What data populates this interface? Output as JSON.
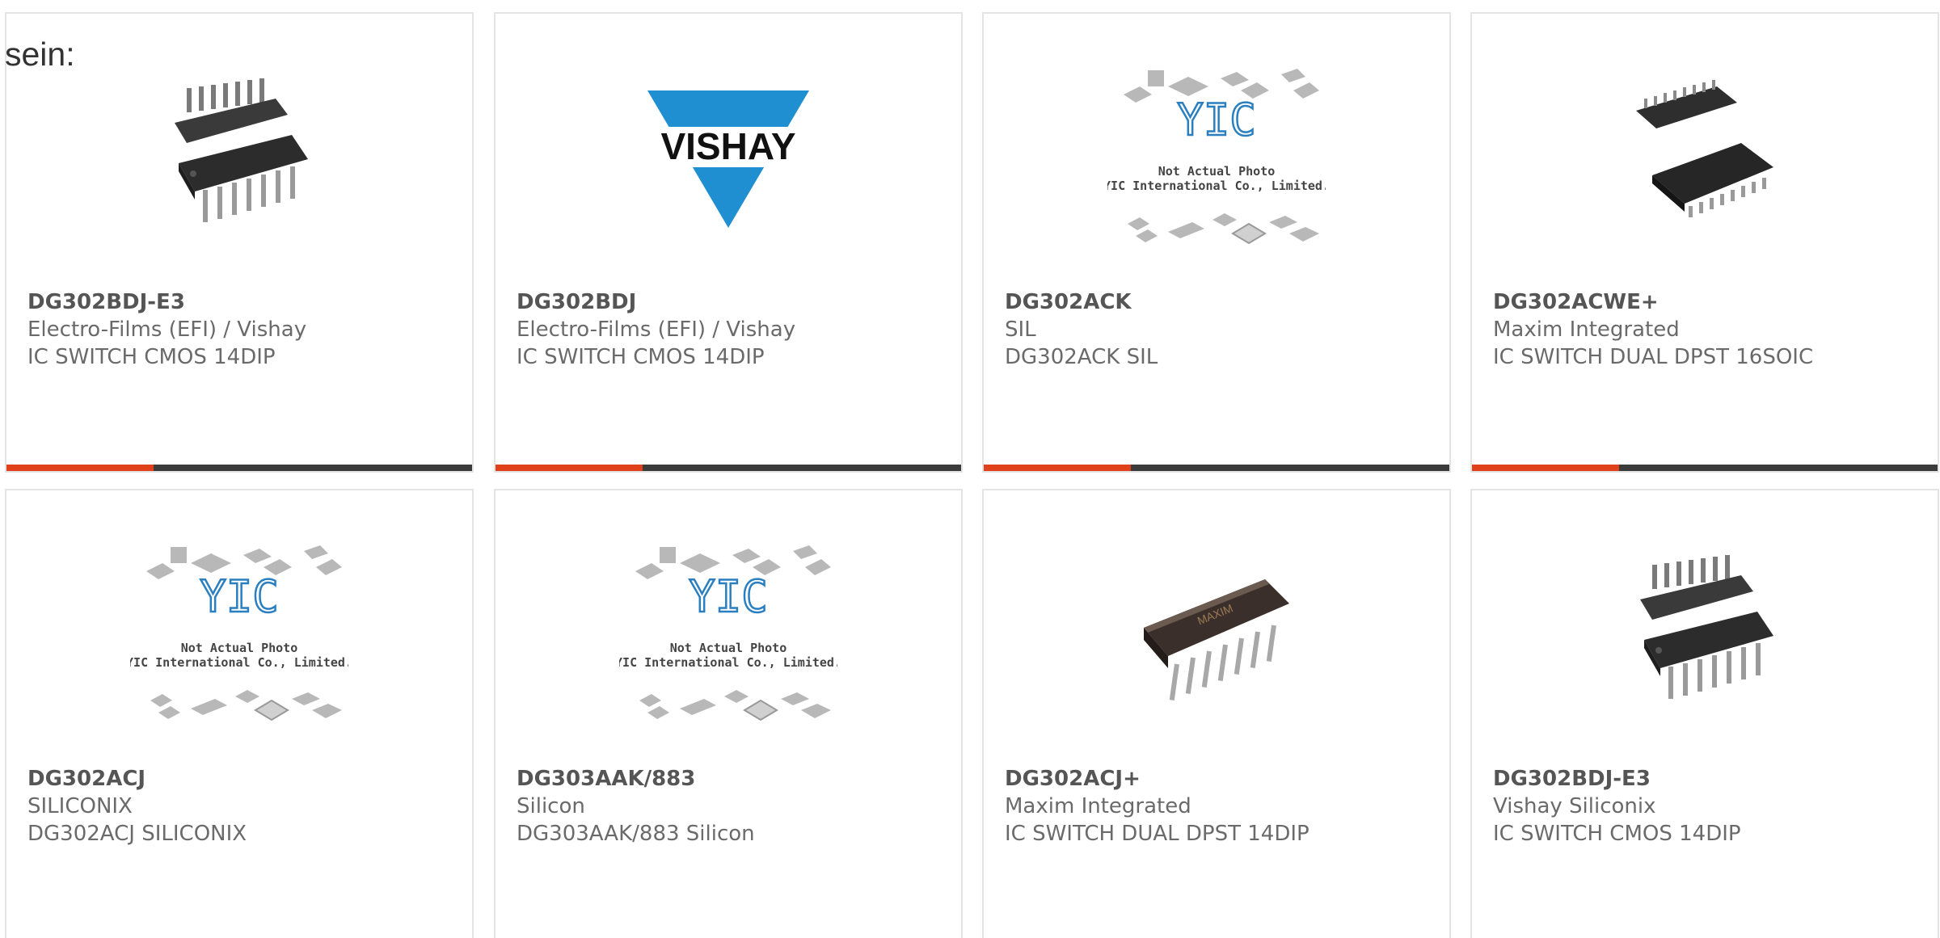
{
  "intro_text": "sein:",
  "cards": [
    {
      "part": "DG302BDJ-E3",
      "manufacturer": "Electro-Films (EFI) / Vishay",
      "description": "IC SWITCH CMOS 14DIP",
      "image": "dip14-chip-icon"
    },
    {
      "part": "DG302BDJ",
      "manufacturer": "Electro-Films (EFI) / Vishay",
      "description": "IC SWITCH CMOS 14DIP",
      "image": "vishay-logo",
      "logo_text": "VISHAY"
    },
    {
      "part": "DG302ACK",
      "manufacturer": "SIL",
      "description": "DG302ACK SIL",
      "image": "yic-placeholder"
    },
    {
      "part": "DG302ACWE+",
      "manufacturer": "Maxim Integrated",
      "description": "IC SWITCH DUAL DPST 16SOIC",
      "image": "soic16-chip-icon"
    },
    {
      "part": "DG302ACJ",
      "manufacturer": "SILICONIX",
      "description": "DG302ACJ SILICONIX",
      "image": "yic-placeholder"
    },
    {
      "part": "DG303AAK/883",
      "manufacturer": "Silicon",
      "description": "DG303AAK/883 Silicon",
      "image": "yic-placeholder"
    },
    {
      "part": "DG302ACJ+",
      "manufacturer": "Maxim Integrated",
      "description": "IC SWITCH DUAL DPST 14DIP",
      "image": "maxim-dip-chip-icon",
      "chip_marking": "MAXIM"
    },
    {
      "part": "DG302BDJ-E3",
      "manufacturer": "Vishay Siliconix",
      "description": "IC SWITCH CMOS 14DIP",
      "image": "dip14-chip-icon"
    }
  ],
  "placeholder": {
    "logo": "YIC",
    "line1": "Not Actual Photo",
    "line2": "YIC International Co., Limited."
  },
  "colors": {
    "accent": "#e0401a",
    "bar": "#3b3b3b",
    "border": "#e4e4e4",
    "vishay_blue": "#1f8fd1"
  }
}
